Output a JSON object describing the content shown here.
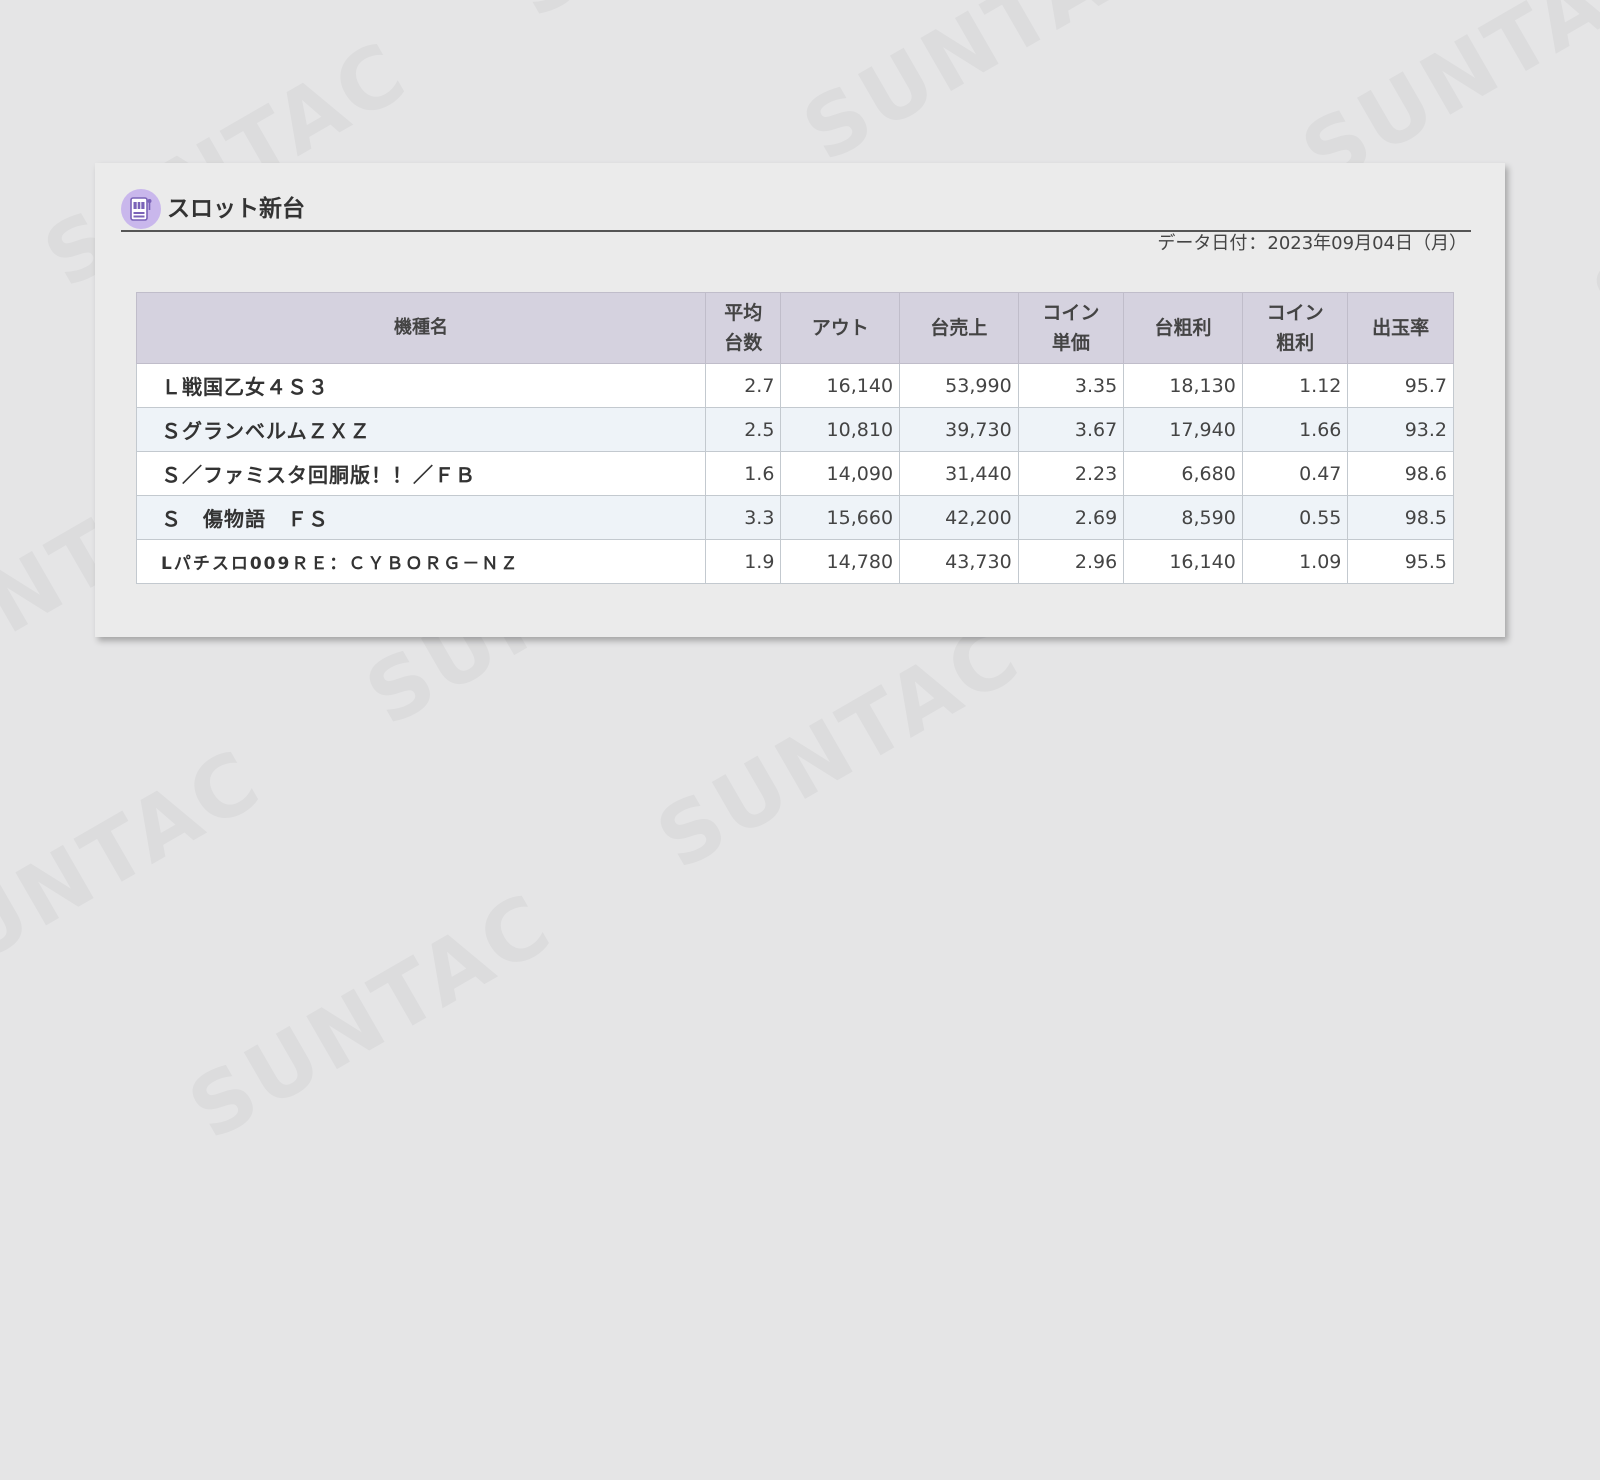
{
  "watermark": {
    "text": "SUNTAC"
  },
  "section": {
    "title": "スロット新台",
    "icon": "slot-machine-icon",
    "accent_color": "#c9b7ec"
  },
  "data_date": {
    "label": "データ日付",
    "separator": "：",
    "value": "2023年09月04日（月）"
  },
  "table": {
    "headers": {
      "name": "機種名",
      "avg_units": [
        "平均",
        "台数"
      ],
      "out": "アウト",
      "sales": "台売上",
      "coin_price": [
        "コイン",
        "単価"
      ],
      "gross_profit": "台粗利",
      "coin_profit": [
        "コイン",
        "粗利"
      ],
      "payout_rate": "出玉率"
    },
    "rows": [
      {
        "name": "Ｌ戦国乙女４Ｓ３",
        "avg_units": "2.7",
        "out": "16,140",
        "sales": "53,990",
        "coin_price": "3.35",
        "gross_profit": "18,130",
        "coin_profit": "1.12",
        "payout_rate": "95.7"
      },
      {
        "name": "ＳグランベルムＺＸＺ",
        "avg_units": "2.5",
        "out": "10,810",
        "sales": "39,730",
        "coin_price": "3.67",
        "gross_profit": "17,940",
        "coin_profit": "1.66",
        "payout_rate": "93.2"
      },
      {
        "name": "Ｓ／ファミスタ回胴版！！／ＦＢ",
        "avg_units": "1.6",
        "out": "14,090",
        "sales": "31,440",
        "coin_price": "2.23",
        "gross_profit": "6,680",
        "coin_profit": "0.47",
        "payout_rate": "98.6"
      },
      {
        "name": "Ｓ　傷物語　ＦＳ",
        "avg_units": "3.3",
        "out": "15,660",
        "sales": "42,200",
        "coin_price": "2.69",
        "gross_profit": "8,590",
        "coin_profit": "0.55",
        "payout_rate": "98.5"
      },
      {
        "name": "Lパチスロ009ＲＥ：ＣＹＢＯＲＧ－ＮＺ",
        "avg_units": "1.9",
        "out": "14,780",
        "sales": "43,730",
        "coin_price": "2.96",
        "gross_profit": "16,140",
        "coin_profit": "1.09",
        "payout_rate": "95.5"
      }
    ]
  }
}
